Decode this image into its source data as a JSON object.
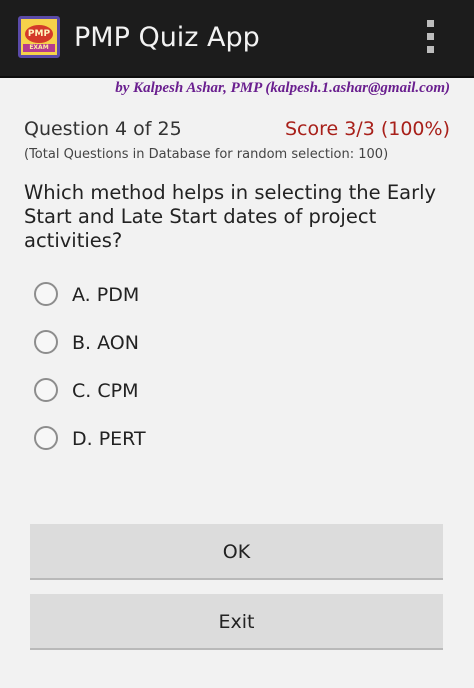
{
  "app_bar": {
    "title": "PMP Quiz App",
    "icon": "pmp-exam-logo",
    "menu_icon": "overflow-menu-icon",
    "background": "#1c1c1c"
  },
  "author_line": "by Kalpesh Ashar, PMP (kalpesh.1.ashar@gmail.com)",
  "quiz": {
    "question_counter": "Question 4 of 25",
    "score": "Score 3/3 (100%)",
    "database_note": "(Total Questions in Database for random selection: 100)",
    "question_text": "Which method helps in selecting the Early Start and Late Start dates of project activities?",
    "options": [
      {
        "label": "A. PDM",
        "selected": false
      },
      {
        "label": "B. AON",
        "selected": false
      },
      {
        "label": "C. CPM",
        "selected": false
      },
      {
        "label": "D. PERT",
        "selected": false
      }
    ]
  },
  "buttons": {
    "ok_label": "OK",
    "exit_label": "Exit"
  },
  "colors": {
    "author": "#6a1f8f",
    "score": "#a8201a",
    "button": "#dcdcdc",
    "background": "#f2f2f2"
  }
}
